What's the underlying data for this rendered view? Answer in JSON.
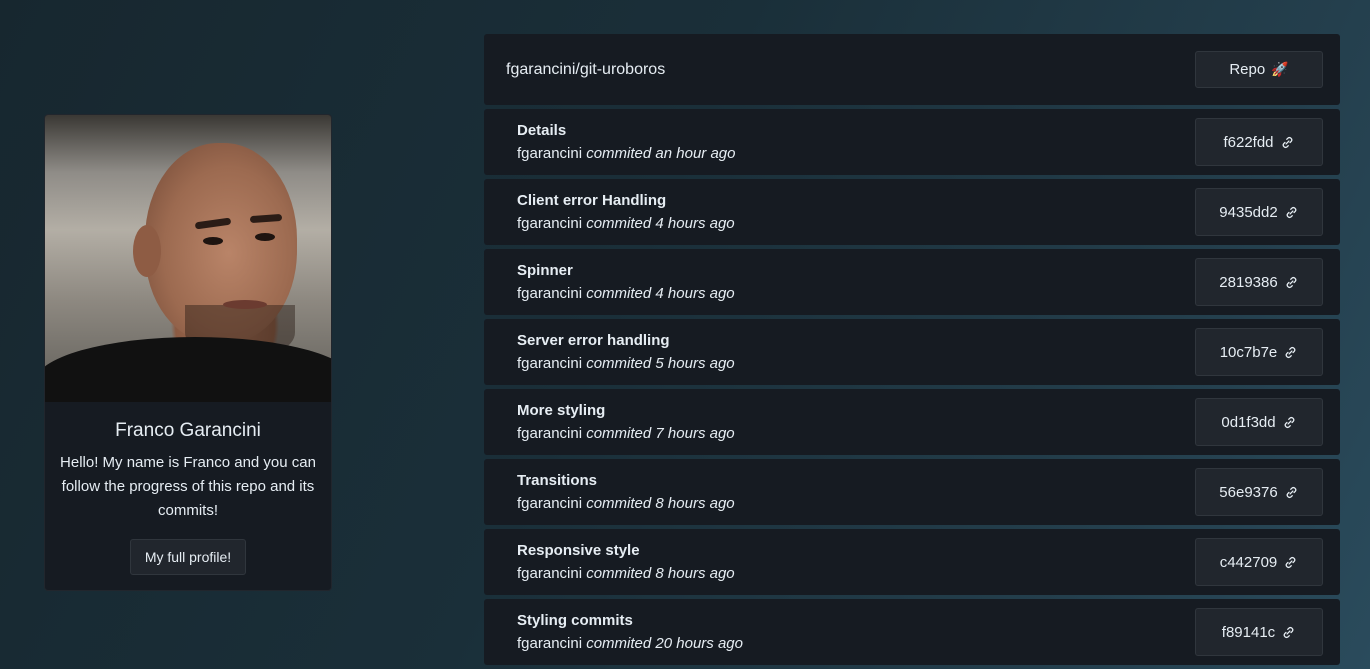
{
  "profile": {
    "name": "Franco Garancini",
    "bio": "Hello! My name is Franco and you can follow the progress of this repo and its commits!",
    "button_label": "My full profile!"
  },
  "repo": {
    "name": "fgarancini/git-uroboros",
    "button_label": "Repo",
    "button_emoji": "🚀"
  },
  "commits": [
    {
      "title": "Details",
      "author": "fgarancini",
      "verb": "commited",
      "time": "an hour ago",
      "sha": "f622fdd"
    },
    {
      "title": "Client error Handling",
      "author": "fgarancini",
      "verb": "commited",
      "time": "4 hours ago",
      "sha": "9435dd2"
    },
    {
      "title": "Spinner",
      "author": "fgarancini",
      "verb": "commited",
      "time": "4 hours ago",
      "sha": "2819386"
    },
    {
      "title": "Server error handling",
      "author": "fgarancini",
      "verb": "commited",
      "time": "5 hours ago",
      "sha": "10c7b7e"
    },
    {
      "title": "More styling",
      "author": "fgarancini",
      "verb": "commited",
      "time": "7 hours ago",
      "sha": "0d1f3dd"
    },
    {
      "title": "Transitions",
      "author": "fgarancini",
      "verb": "commited",
      "time": "8 hours ago",
      "sha": "56e9376"
    },
    {
      "title": "Responsive style",
      "author": "fgarancini",
      "verb": "commited",
      "time": "8 hours ago",
      "sha": "c442709"
    },
    {
      "title": "Styling commits",
      "author": "fgarancini",
      "verb": "commited",
      "time": "20 hours ago",
      "sha": "f89141c"
    }
  ],
  "colors": {
    "card_bg": "#161b22",
    "button_bg": "#21262d",
    "text": "#e6edf3"
  }
}
